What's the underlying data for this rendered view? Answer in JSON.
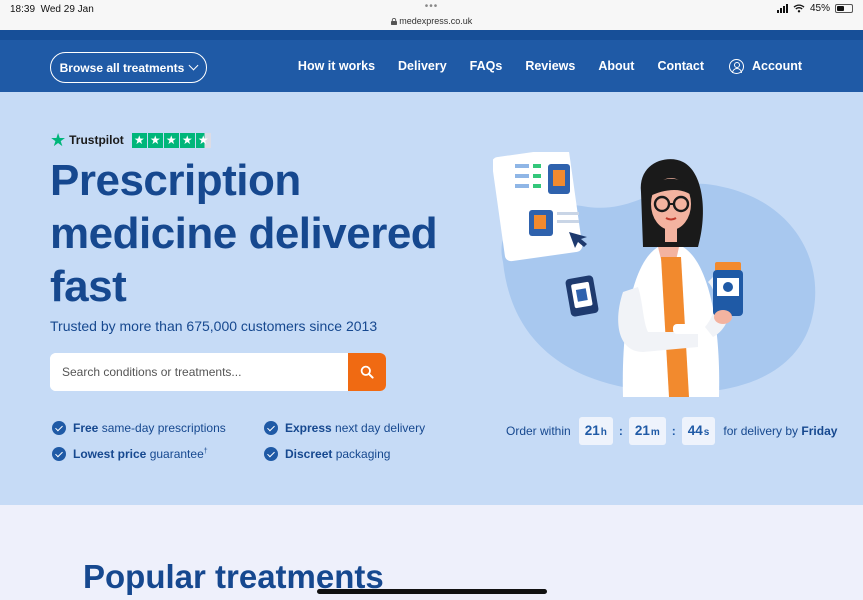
{
  "status_bar": {
    "time": "18:39",
    "date": "Wed 29 Jan",
    "dots": "•••",
    "url": "medexpress.co.uk",
    "battery": "45%"
  },
  "nav": {
    "browse_label": "Browse all treatments",
    "links": [
      "How it works",
      "Delivery",
      "FAQs",
      "Reviews",
      "About",
      "Contact"
    ],
    "account_label": "Account"
  },
  "hero": {
    "trustpilot": "Trustpilot",
    "trustpilot_rating": 4.5,
    "headline_lines": [
      "Prescription",
      "medicine delivered",
      "fast"
    ],
    "subline": "Trusted by more than 675,000 customers since 2013",
    "search_placeholder": "Search conditions or treatments...",
    "features": [
      {
        "bold": "Free",
        "rest": " same-day prescriptions",
        "sup": ""
      },
      {
        "bold": "Express",
        "rest": " next day delivery",
        "sup": ""
      },
      {
        "bold": "Lowest price",
        "rest": " guarantee",
        "sup": "†"
      },
      {
        "bold": "Discreet",
        "rest": " packaging",
        "sup": ""
      }
    ],
    "order": {
      "lead": "Order within",
      "hours": "21",
      "hours_unit": "h",
      "minutes": "21",
      "minutes_unit": "m",
      "seconds": "44",
      "seconds_unit": "s",
      "tail": "for delivery by",
      "day": "Friday"
    }
  },
  "popular_heading": "Popular treatments",
  "colors": {
    "nav": "#1f5aa6",
    "hero_bg": "#c6dbf6",
    "brand_text": "#16488f",
    "search_button": "#f06a12",
    "trustpilot_green": "#00b67a"
  },
  "icons": [
    "wifi-icon",
    "battery-icon",
    "lock-icon",
    "chevron-down-icon",
    "account-icon",
    "search-icon",
    "check-icon",
    "trustpilot-star-icon"
  ]
}
